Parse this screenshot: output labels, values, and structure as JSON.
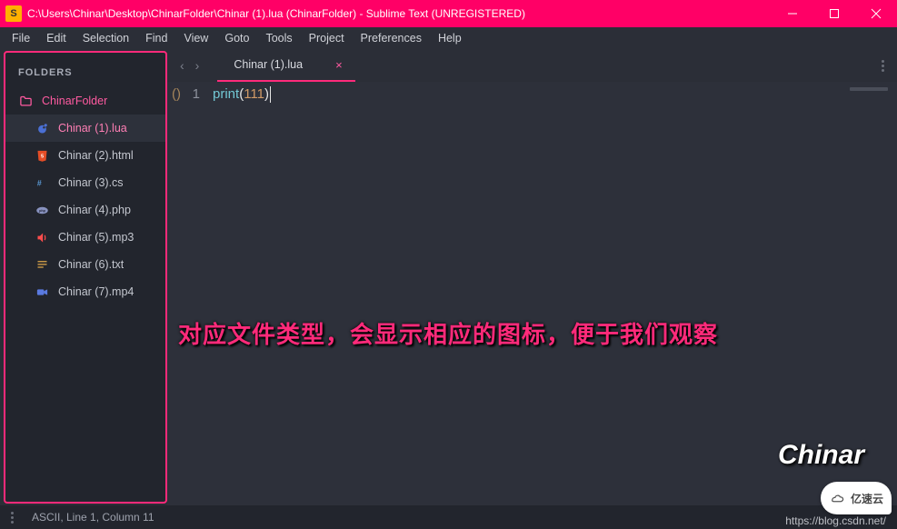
{
  "titlebar": {
    "app_icon_letter": "S",
    "path": "C:\\Users\\Chinar\\Desktop\\ChinarFolder\\Chinar (1).lua (ChinarFolder) - Sublime Text (UNREGISTERED)"
  },
  "menubar": {
    "items": [
      "File",
      "Edit",
      "Selection",
      "Find",
      "View",
      "Goto",
      "Tools",
      "Project",
      "Preferences",
      "Help"
    ]
  },
  "sidebar": {
    "header": "FOLDERS",
    "folder_name": "ChinarFolder",
    "files": [
      {
        "name": "Chinar (1).lua",
        "icon": "lua",
        "active": true
      },
      {
        "name": "Chinar (2).html",
        "icon": "html",
        "active": false
      },
      {
        "name": "Chinar (3).cs",
        "icon": "cs",
        "active": false
      },
      {
        "name": "Chinar (4).php",
        "icon": "php",
        "active": false
      },
      {
        "name": "Chinar (5).mp3",
        "icon": "audio",
        "active": false
      },
      {
        "name": "Chinar (6).txt",
        "icon": "text",
        "active": false
      },
      {
        "name": "Chinar (7).mp4",
        "icon": "video",
        "active": false
      }
    ]
  },
  "tabs": {
    "active_label": "Chinar (1).lua"
  },
  "code": {
    "fold_marker": "()",
    "line_number": "1",
    "token_fn": "print",
    "token_lpar": "(",
    "token_num": "111",
    "token_rpar": ")"
  },
  "annotation": {
    "text": "对应文件类型，会显示相应的图标，便于我们观察",
    "brand": "Chinar"
  },
  "statusbar": {
    "text": "ASCII, Line 1, Column 11"
  },
  "watermark": {
    "url": "https://blog.csdn.net/",
    "logo_text": "亿速云"
  }
}
